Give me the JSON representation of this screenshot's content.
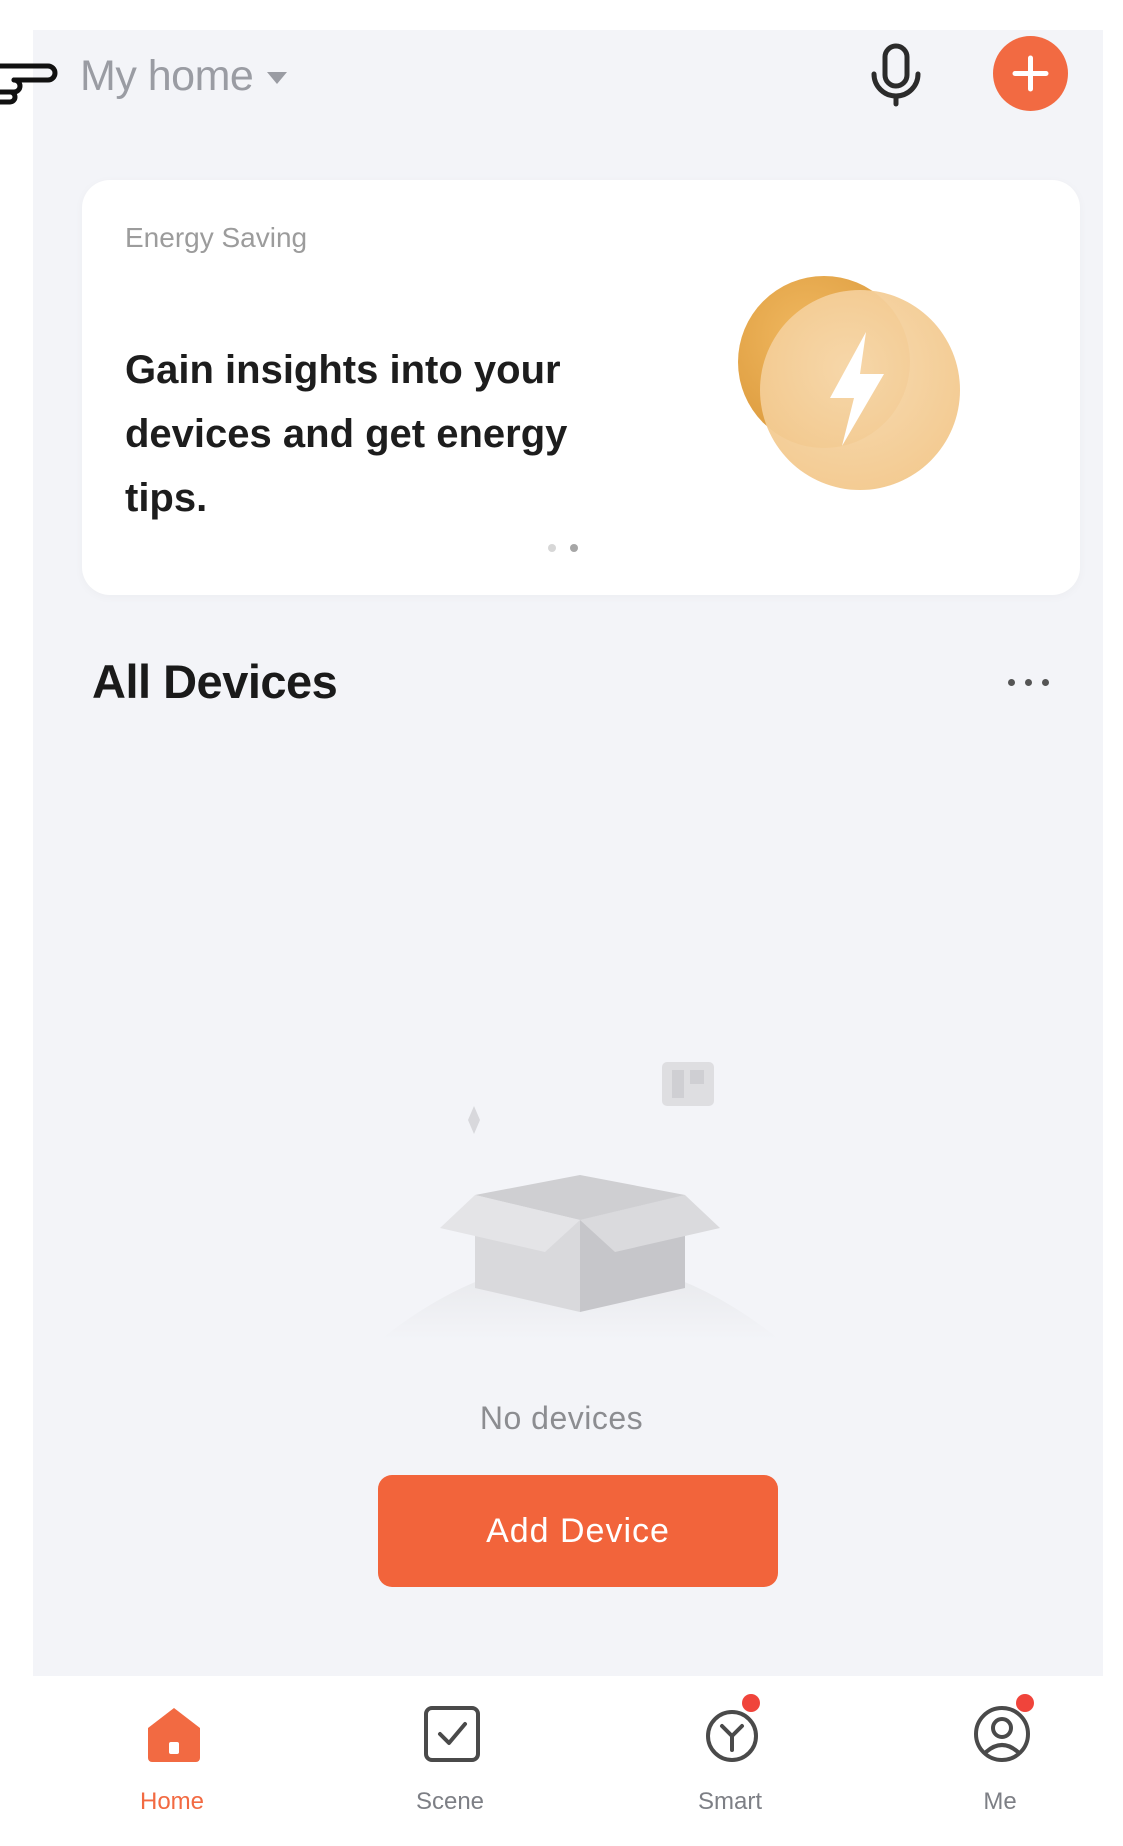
{
  "header": {
    "home_name": "My home",
    "accent_color": "#f26a42"
  },
  "energy_card": {
    "tag": "Energy Saving",
    "headline": "Gain insights into your devices and get energy tips.",
    "icon": "lightning-bolt-icon",
    "carousel": {
      "page_count": 2,
      "active_page": 2
    }
  },
  "devices": {
    "title": "All Devices",
    "empty_text": "No devices",
    "add_button_label": "Add Device"
  },
  "tabs": [
    {
      "label": "Home",
      "icon": "home-icon",
      "active": true,
      "badge": false
    },
    {
      "label": "Scene",
      "icon": "scene-checkbox-icon",
      "active": false,
      "badge": false
    },
    {
      "label": "Smart",
      "icon": "smart-icon",
      "active": false,
      "badge": true
    },
    {
      "label": "Me",
      "icon": "profile-icon",
      "active": false,
      "badge": true
    }
  ]
}
